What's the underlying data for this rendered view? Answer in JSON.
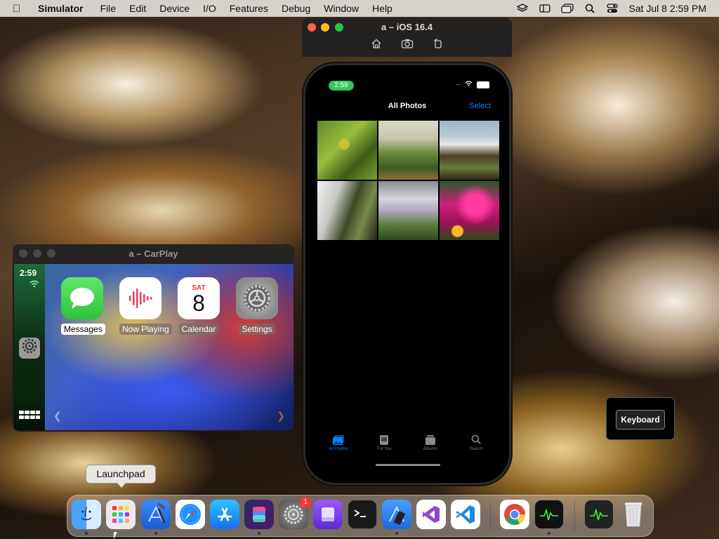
{
  "menubar": {
    "apple_icon": "apple-icon",
    "app_name": "Simulator",
    "menus": [
      "File",
      "Edit",
      "Device",
      "I/O",
      "Features",
      "Debug",
      "Window",
      "Help"
    ],
    "clock": "Sat Jul 8  2:59 PM",
    "status_icons": [
      "stack-icon",
      "sidebar-icon",
      "windows-icon",
      "search-icon",
      "control-center-icon"
    ]
  },
  "simulator": {
    "title": "a – iOS 16.4",
    "tools": [
      "home-icon",
      "screenshot-icon",
      "rotate-icon"
    ],
    "status_time": "2:59",
    "nav_title": "All Photos",
    "nav_action": "Select",
    "tabs": [
      {
        "label": "All Photos",
        "icon": "photos-icon",
        "active": true
      },
      {
        "label": "For You",
        "icon": "for-you-icon",
        "active": false
      },
      {
        "label": "Albums",
        "icon": "albums-icon",
        "active": false
      },
      {
        "label": "Search",
        "icon": "search-icon",
        "active": false
      }
    ]
  },
  "carplay": {
    "title": "a – CarPlay",
    "time": "2:59",
    "apps": [
      {
        "label": "Messages",
        "selected": true
      },
      {
        "label": "Now Playing",
        "selected": false
      },
      {
        "label": "Calendar",
        "selected": false
      },
      {
        "label": "Settings",
        "selected": false
      }
    ],
    "calendar_day": "SAT",
    "calendar_date": "8"
  },
  "keyboard_panel": {
    "label": "Keyboard"
  },
  "tooltip": {
    "label": "Launchpad"
  },
  "dock": {
    "items": [
      {
        "name": "finder",
        "running": true
      },
      {
        "name": "launchpad",
        "running": false
      },
      {
        "name": "xcode",
        "running": true
      },
      {
        "name": "safari",
        "running": false
      },
      {
        "name": "app-store",
        "running": false
      },
      {
        "name": "shortcuts",
        "running": true
      },
      {
        "name": "system-settings",
        "running": false,
        "badge": "1"
      },
      {
        "name": "disk-utility",
        "running": false
      },
      {
        "name": "terminal",
        "running": false
      },
      {
        "name": "simulator",
        "running": true
      },
      {
        "name": "visual-studio",
        "running": false
      },
      {
        "name": "vscode",
        "running": false
      },
      {
        "name": "chrome",
        "running": false
      },
      {
        "name": "activity-monitor",
        "running": true
      },
      {
        "name": "activity-monitor-2",
        "running": false
      },
      {
        "name": "trash",
        "running": false
      }
    ]
  }
}
